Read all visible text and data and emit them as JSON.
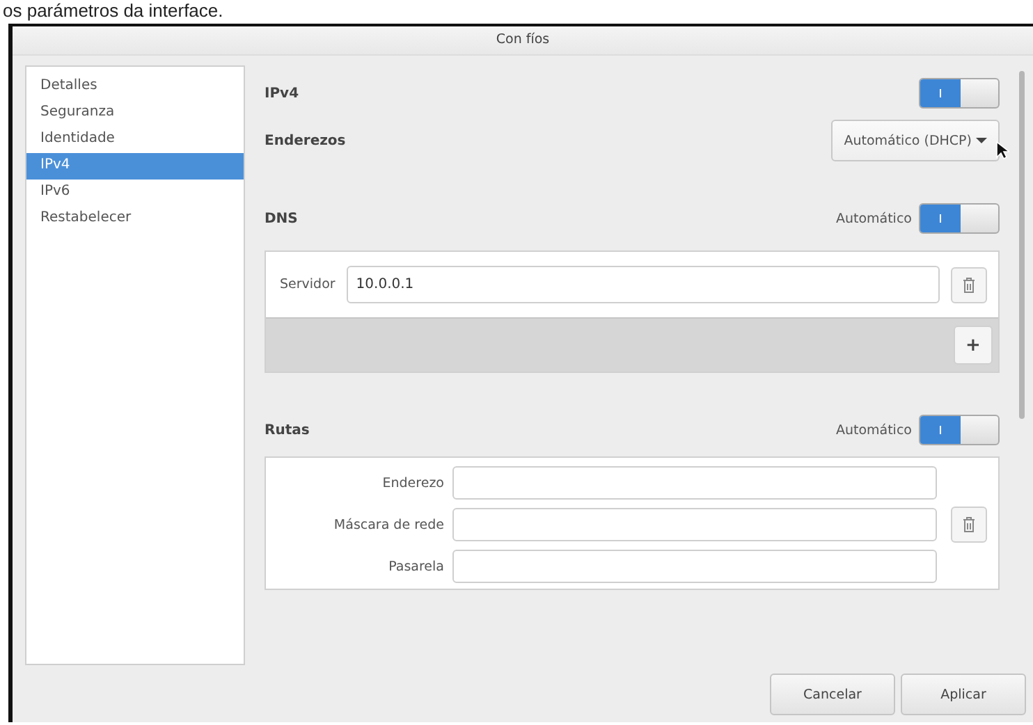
{
  "caption": "os parámetros da interface.",
  "window": {
    "title": "Con fíos"
  },
  "sidebar": {
    "items": [
      {
        "label": "Detalles",
        "selected": false
      },
      {
        "label": "Seguranza",
        "selected": false
      },
      {
        "label": "Identidade",
        "selected": false
      },
      {
        "label": "IPv4",
        "selected": true
      },
      {
        "label": "IPv6",
        "selected": false
      },
      {
        "label": "Restabelecer",
        "selected": false
      }
    ]
  },
  "ipv4": {
    "label": "IPv4",
    "on": true
  },
  "addresses": {
    "label": "Enderezos",
    "dropdown": "Automático (DHCP)"
  },
  "dns": {
    "label": "DNS",
    "auto_label": "Automático",
    "automatic": true,
    "servers": [
      {
        "label": "Servidor",
        "value": "10.0.0.1"
      }
    ],
    "add": "+"
  },
  "routes": {
    "label": "Rutas",
    "auto_label": "Automático",
    "automatic": true,
    "fields": [
      {
        "label": "Enderezo"
      },
      {
        "label": "Máscara de rede"
      },
      {
        "label": "Pasarela"
      }
    ]
  },
  "buttons": [
    {
      "label": "Cancelar"
    },
    {
      "label": "Aplicar"
    }
  ]
}
